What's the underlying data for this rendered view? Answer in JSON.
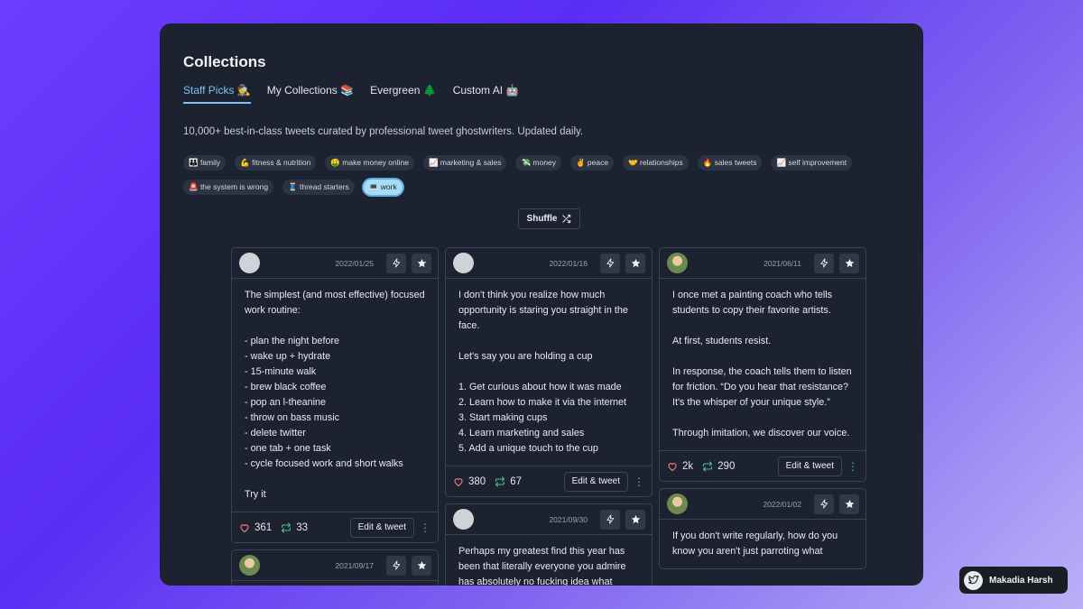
{
  "header": {
    "title": "Collections"
  },
  "tabs": [
    {
      "label": "Staff Picks 🕵️"
    },
    {
      "label": "My Collections 📚"
    },
    {
      "label": "Evergreen 🌲"
    },
    {
      "label": "Custom AI 🤖"
    }
  ],
  "description": "10,000+ best-in-class tweets curated by professional tweet ghostwriters. Updated daily.",
  "tags": [
    "👪 family",
    "💪 fitness & nutrition",
    "🤑 make money online",
    "📈 marketing & sales",
    "💸 money",
    "✌️ peace",
    "🤝 relationships",
    "🔥 sales tweets",
    "📈 self improvement",
    "🚨 the system is wrong",
    "🧵 thread starters",
    "💻 work"
  ],
  "selected_tag": "💻 work",
  "shuffle_label": "Shuffle",
  "cards": [
    {
      "date": "2022/01/25",
      "text": "The simplest (and most effective) focused work routine:\n\n- plan the night before\n- wake up + hydrate\n- 15-minute walk\n- brew black coffee\n- pop an l-theanine\n- throw on bass music\n- delete twitter\n- one tab + one task\n- cycle focused work and short walks\n\nTry it",
      "likes": "361",
      "retweets": "33",
      "edit_label": "Edit & tweet"
    },
    {
      "date": "2021/09/17"
    },
    {
      "date": "2022/01/16",
      "text": "I don't think you realize how much opportunity is staring you straight in the face.\n\nLet's say you are holding a cup\n\n1. Get curious about how it was made\n2. Learn how to make it via the internet\n3. Start making cups\n4. Learn marketing and sales\n5. Add a unique touch to the cup",
      "likes": "380",
      "retweets": "67",
      "edit_label": "Edit & tweet"
    },
    {
      "date": "2021/09/30",
      "text": "Perhaps my greatest find this year has been that literally everyone you admire has absolutely no fucking idea what"
    },
    {
      "date": "2021/06/11",
      "text": "I once met a painting coach who tells students to copy their favorite artists.\n\nAt first, students resist.\n\nIn response, the coach tells them to listen for friction. “Do you hear that resistance? It's the whisper of your unique style.”\n\nThrough imitation, we discover our voice.",
      "likes": "2k",
      "retweets": "290",
      "edit_label": "Edit & tweet"
    },
    {
      "date": "2022/01/02",
      "text": "If you don't write regularly, how do you know you aren't just parroting what"
    }
  ],
  "author": {
    "name": "Makadia Harsh"
  },
  "icons": {
    "generate": "bolt-icon",
    "favorite": "star-icon",
    "like": "heart-icon",
    "retweet": "retweet-icon",
    "shuffle": "shuffle-icon",
    "more": "more-vertical-icon"
  },
  "colors": {
    "accent": "#7cc3f2",
    "like": "#f07c7c",
    "retweet": "#4cc38a",
    "panel": "#1c2230"
  }
}
